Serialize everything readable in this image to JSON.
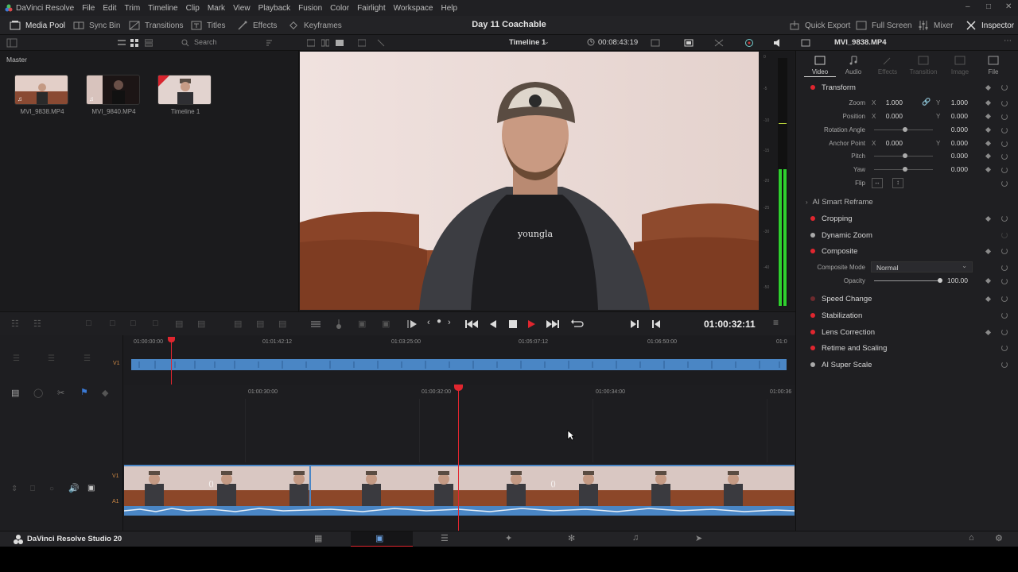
{
  "menu": {
    "app": "DaVinci Resolve",
    "items": [
      "File",
      "Edit",
      "Trim",
      "Timeline",
      "Clip",
      "Mark",
      "View",
      "Playback",
      "Fusion",
      "Color",
      "Fairlight",
      "Workspace",
      "Help"
    ]
  },
  "toolbar": {
    "media_pool": "Media Pool",
    "sync_bin": "Sync Bin",
    "transitions": "Transitions",
    "titles": "Titles",
    "effects": "Effects",
    "keyframes": "Keyframes",
    "project_title": "Day 11 Coachable",
    "quick_export": "Quick Export",
    "full_screen": "Full Screen",
    "mixer": "Mixer",
    "inspector": "Inspector"
  },
  "subbar": {
    "search_placeholder": "Search",
    "timeline_name": "Timeline 1",
    "timecode": "00:08:43:19"
  },
  "media_pool": {
    "bin": "Master",
    "clips": [
      {
        "name": "MVI_9838.MP4"
      },
      {
        "name": "MVI_9840.MP4"
      },
      {
        "name": "Timeline 1"
      }
    ]
  },
  "transport": {
    "timecode": "01:00:32:11"
  },
  "upper_ruler": [
    "01:00:00:00",
    "01:01:42:12",
    "01:03:25:00",
    "01:05:07:12",
    "01:06:50:00",
    "01:0"
  ],
  "lower_ruler": [
    "01:00:30:00",
    "01:00:32:00",
    "01:00:34:00",
    "01:00:36"
  ],
  "tracks": {
    "v1": "V1",
    "a1": "A1"
  },
  "meter_scale": [
    "0",
    "-5",
    "-10",
    "-15",
    "-20",
    "-25",
    "-30",
    "-40",
    "-50"
  ],
  "inspector": {
    "clip_name": "MVI_9838.MP4",
    "tabs": [
      {
        "label": "Video",
        "active": true
      },
      {
        "label": "Audio",
        "active": true
      },
      {
        "label": "Effects",
        "active": false
      },
      {
        "label": "Transition",
        "active": false
      },
      {
        "label": "Image",
        "active": false
      },
      {
        "label": "File",
        "active": true
      }
    ],
    "transform": {
      "title": "Transform",
      "zoom_label": "Zoom",
      "zoom_x": "1.000",
      "zoom_y": "1.000",
      "position_label": "Position",
      "position_x": "0.000",
      "position_y": "0.000",
      "rotation_label": "Rotation Angle",
      "rotation": "0.000",
      "anchor_label": "Anchor Point",
      "anchor_x": "0.000",
      "anchor_y": "0.000",
      "pitch_label": "Pitch",
      "pitch": "0.000",
      "yaw_label": "Yaw",
      "yaw": "0.000",
      "flip_label": "Flip",
      "axis_x": "X",
      "axis_y": "Y"
    },
    "smart_reframe": "AI Smart Reframe",
    "cropping": "Cropping",
    "dynamic_zoom": "Dynamic Zoom",
    "composite": {
      "title": "Composite",
      "mode_label": "Composite Mode",
      "mode_value": "Normal",
      "opacity_label": "Opacity",
      "opacity_value": "100.00"
    },
    "speed_change": "Speed Change",
    "stabilization": "Stabilization",
    "lens_correction": "Lens Correction",
    "retime": "Retime and Scaling",
    "super_scale": "AI Super Scale"
  },
  "pagebar": {
    "app_name": "DaVinci Resolve Studio 20"
  },
  "colors": {
    "accent_red": "#e0262f",
    "clip_blue": "#4a86c5",
    "meter_green": "#2fd02f"
  }
}
